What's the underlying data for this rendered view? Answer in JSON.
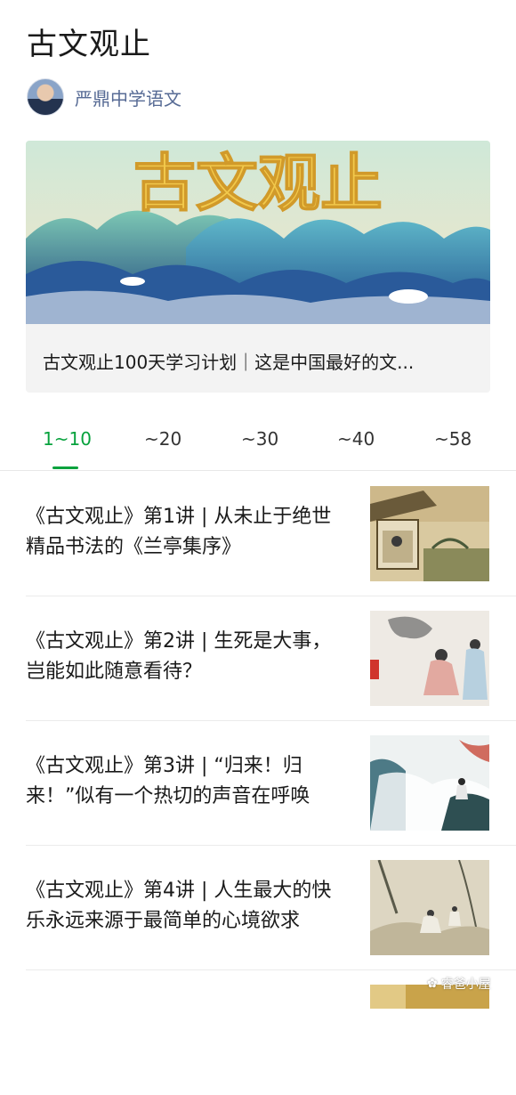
{
  "page": {
    "title": "古文观止"
  },
  "author": {
    "name": "严鼎中学语文"
  },
  "banner": {
    "art_text": "古文观止",
    "caption": "古文观止100天学习计划｜这是中国最好的文..."
  },
  "tabs": [
    {
      "label": "1~10",
      "active": true
    },
    {
      "label": "~20",
      "active": false
    },
    {
      "label": "~30",
      "active": false
    },
    {
      "label": "~40",
      "active": false
    },
    {
      "label": "~58",
      "active": false
    }
  ],
  "articles": [
    {
      "title": "《古文观止》第1讲 | 从未止于绝世精品书法的《兰亭集序》",
      "thumb_icon": "pavilion-painting"
    },
    {
      "title": "《古文观止》第2讲 | 生死是大事，岂能如此随意看待？",
      "thumb_icon": "scholars-painting"
    },
    {
      "title": "《古文观止》第3讲 | “归来！归来！”似有一个热切的声音在呼唤",
      "thumb_icon": "cliff-figure-painting"
    },
    {
      "title": "《古文观止》第4讲 | 人生最大的快乐永远来源于最简单的心境欲求",
      "thumb_icon": "landscape-figures-painting"
    },
    {
      "title": "",
      "thumb_icon": "painting-partial"
    }
  ],
  "watermark": {
    "text": "睿爸小屋",
    "icon": "wechat-icon"
  },
  "colors": {
    "accent": "#07a23d",
    "author_link": "#576b95"
  }
}
